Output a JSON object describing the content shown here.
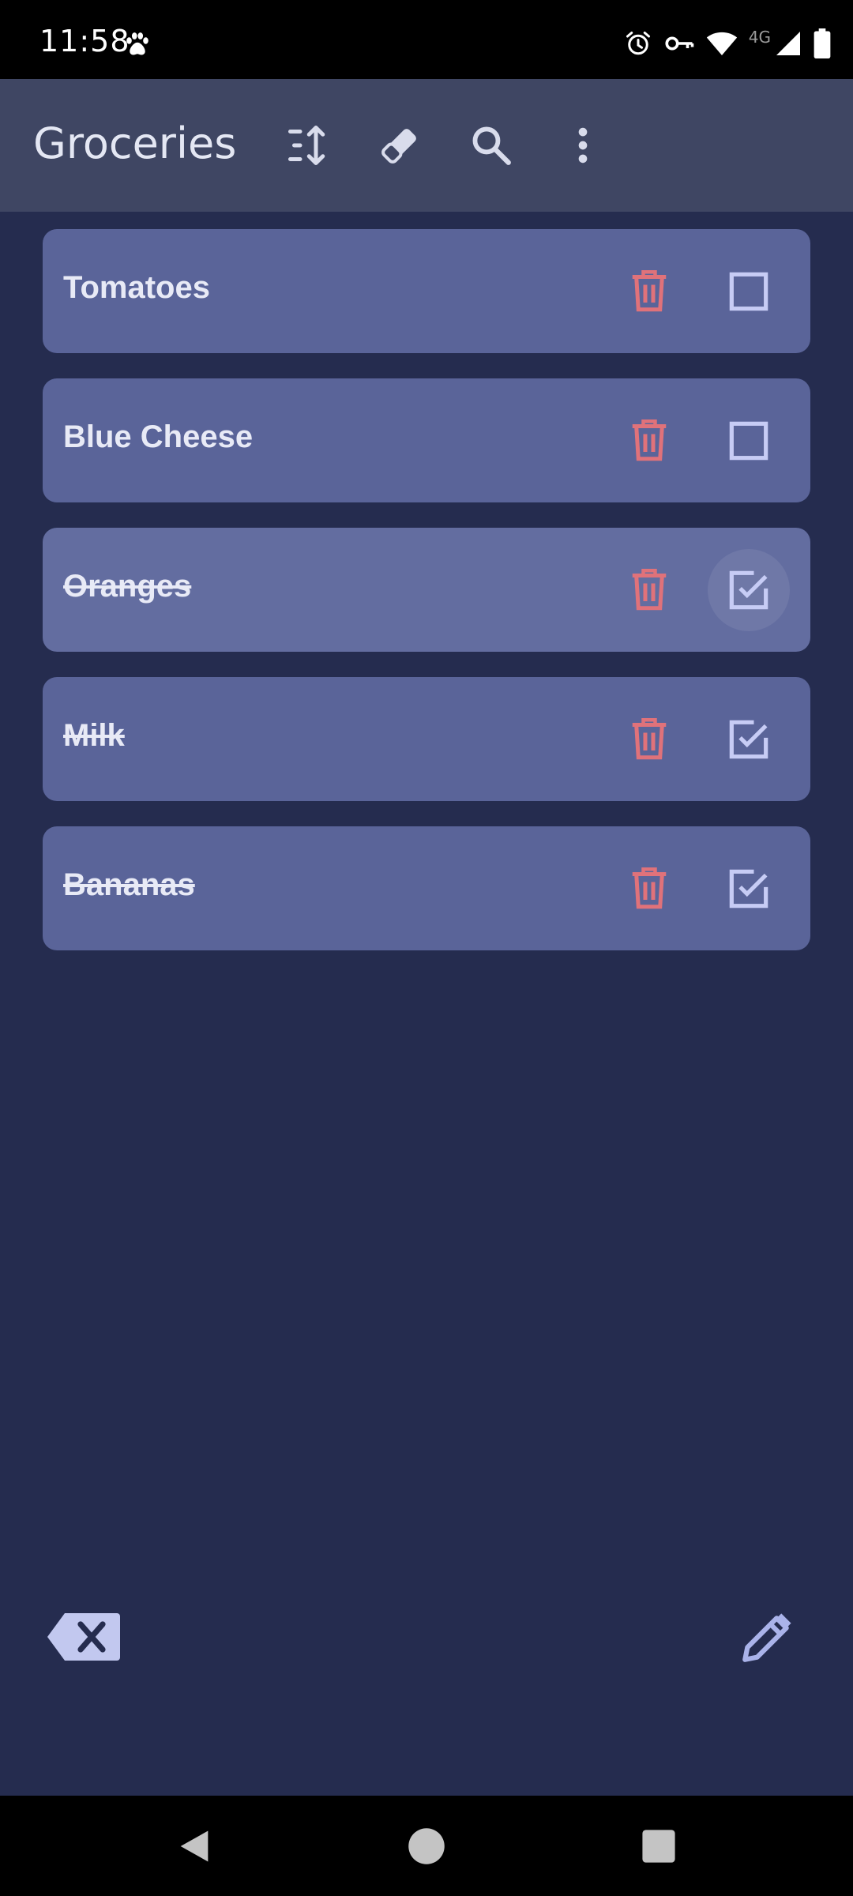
{
  "status_bar": {
    "time": "11:58",
    "network_label": "4G",
    "icons": [
      "paw-icon",
      "alarm-icon",
      "vpn-key-icon",
      "wifi-icon",
      "cellular-signal-icon",
      "battery-icon"
    ]
  },
  "app_bar": {
    "title": "Groceries",
    "actions": [
      "sort-icon",
      "eraser-icon",
      "search-icon",
      "more-vert-icon"
    ]
  },
  "items": [
    {
      "label": "Tomatoes",
      "checked": false
    },
    {
      "label": "Blue Cheese",
      "checked": false
    },
    {
      "label": "Oranges",
      "checked": true
    },
    {
      "label": "Milk",
      "checked": true
    },
    {
      "label": "Bananas",
      "checked": true
    }
  ],
  "bottom_actions": [
    "backspace-clear-icon",
    "pencil-edit-icon"
  ],
  "nav_bar": [
    "back-icon",
    "home-icon",
    "recents-icon"
  ],
  "colors": {
    "app_bar": "#3f4663",
    "background": "#252c4f",
    "card": "#5a6499",
    "delete_icon": "#e0727a",
    "checkbox_icon": "#c7ccf5",
    "text": "#e8eaf6"
  }
}
